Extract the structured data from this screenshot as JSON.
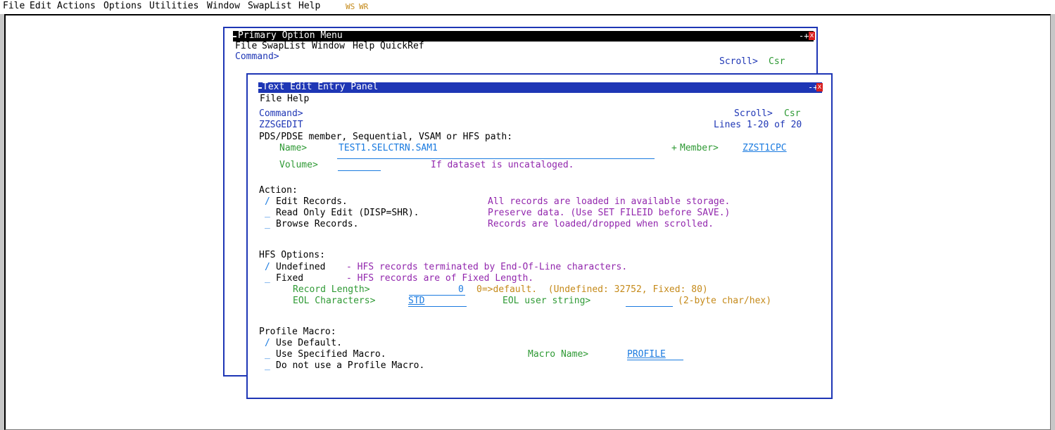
{
  "menubar": {
    "items": [
      "File",
      "Edit",
      "Actions",
      "Options",
      "Utilities",
      "Window",
      "SwapList",
      "Help"
    ],
    "ws_label": "WS",
    "wr_label": "WR"
  },
  "primary": {
    "title": "Primary Option Menu",
    "menu": [
      "File",
      "SwapList",
      "Window",
      "Help",
      "QuickRef"
    ],
    "command_label": "Command>",
    "scroll_label": "Scroll>",
    "scroll_value": "Csr"
  },
  "tedit": {
    "title": "Text Edit Entry Panel",
    "menu": [
      "File",
      "Help"
    ],
    "command_label": "Command>",
    "scroll_label": "Scroll>",
    "scroll_value": "Csr",
    "panel_id": "ZZSGEDIT",
    "lines_info": "Lines 1-20 of 20",
    "path_heading": "PDS/PDSE member, Sequential, VSAM or HFS path:",
    "name_label": "Name>",
    "name_value": "TEST1.SELCTRN.SAM1",
    "member_plus": "+",
    "member_label": "Member>",
    "member_value": "ZZST1CPC",
    "volume_label": "Volume>",
    "volume_value": "",
    "volume_hint": "If dataset is uncataloged.",
    "action_heading": "Action:",
    "actions": [
      {
        "mark": "/",
        "label": "Edit Records.",
        "desc": "All records are loaded in available storage."
      },
      {
        "mark": "_",
        "label": "Read Only Edit (DISP=SHR).",
        "desc": "Preserve data. (Use SET FILEID before SAVE.)"
      },
      {
        "mark": "_",
        "label": "Browse Records.",
        "desc": "Records are loaded/dropped when scrolled."
      }
    ],
    "hfs_heading": "HFS Options:",
    "hfs_options": [
      {
        "mark": "/",
        "label": "Undefined",
        "desc": "- HFS records terminated by End-Of-Line characters."
      },
      {
        "mark": "_",
        "label": "Fixed",
        "desc": "- HFS records are of Fixed Length."
      }
    ],
    "reclen_label": "Record Length>",
    "reclen_value": "0",
    "reclen_hint": "0=>default.  (Undefined: 32752, Fixed: 80)",
    "eol_label": "EOL Characters>",
    "eol_value": "STD",
    "eol_user_label": "EOL user string>",
    "eol_user_value": "",
    "eol_user_hint": "(2-byte char/hex)",
    "profile_heading": "Profile Macro:",
    "profile_options": [
      {
        "mark": "/",
        "label": "Use Default."
      },
      {
        "mark": "_",
        "label": "Use Specified Macro."
      },
      {
        "mark": "_",
        "label": "Do not use a Profile Macro."
      }
    ],
    "macro_label": "Macro Name>",
    "macro_value": "PROFILE"
  },
  "colors": {
    "title_active": "#1e36b5",
    "title_inactive": "#000000",
    "label_green": "#2f9a35",
    "text_purple": "#9227ad",
    "hint_orange": "#c58a1a",
    "input_cyan": "#1b7be0"
  }
}
